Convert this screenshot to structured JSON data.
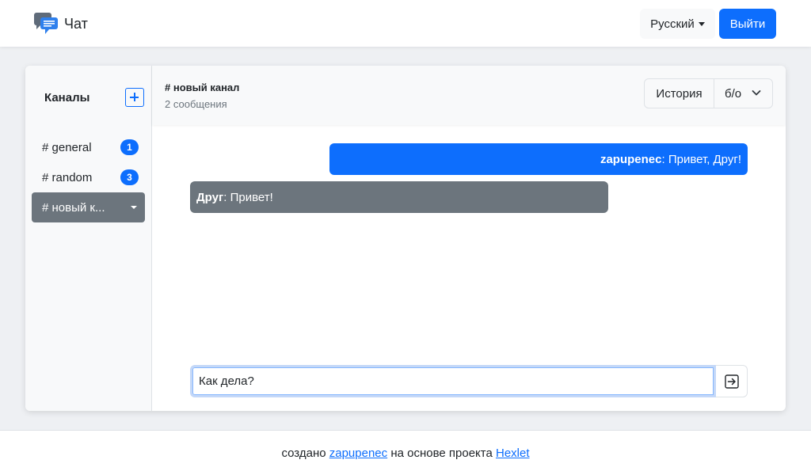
{
  "navbar": {
    "brand": "Чат",
    "language": "Русский",
    "logout": "Выйти"
  },
  "sidebar": {
    "title": "Каналы",
    "channels": [
      {
        "label": "# general",
        "badge": "1"
      },
      {
        "label": "# random",
        "badge": "3"
      },
      {
        "label": "# новый к..."
      }
    ]
  },
  "chat": {
    "title": "# новый канал",
    "count": "2 сообщения",
    "history_button": "История",
    "filter_value": "б/о",
    "messages": [
      {
        "author": "zapupenec",
        "text": ": Привет, Друг!"
      },
      {
        "author": "Друг",
        "text": ": Привет!"
      }
    ],
    "input_value": "Как дела?"
  },
  "footer": {
    "prefix": "создано",
    "author_link": "zapupenec",
    "middle": "на основе проекта",
    "project_link": "Hexlet"
  },
  "colors": {
    "primary": "#0d6efd",
    "secondary": "#6c757d",
    "background": "#eef0f3"
  }
}
